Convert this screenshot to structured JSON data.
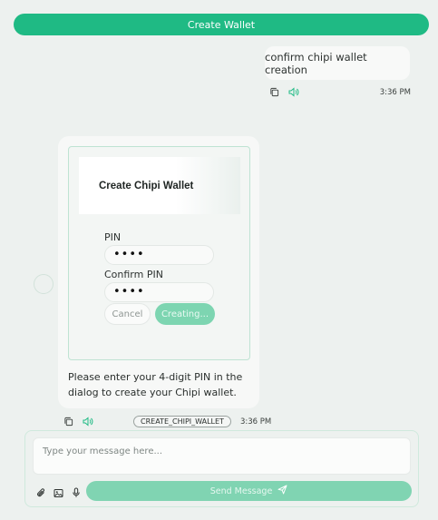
{
  "header": {
    "create_wallet_label": "Create Wallet"
  },
  "user_message": {
    "text": "confirm chipi wallet creation",
    "time": "3:36 PM"
  },
  "bot_message": {
    "dialog": {
      "title": "Create Chipi Wallet",
      "pin_label": "PIN",
      "pin_value": "••••",
      "confirm_label": "Confirm PIN",
      "confirm_value": "••••",
      "cancel_label": "Cancel",
      "creating_label": "Creating..."
    },
    "text": "Please enter your 4-digit PIN in the dialog to create your Chipi wallet.",
    "tool_badge": "CREATE_CHIPI_WALLET",
    "time": "3:36 PM"
  },
  "composer": {
    "placeholder": "Type your message here...",
    "send_label": "Send Message"
  },
  "icons": {
    "copy": "copy-icon",
    "speaker": "speaker-icon",
    "attach": "paperclip-icon",
    "image": "image-icon",
    "mic": "microphone-icon",
    "send": "send-icon"
  },
  "colors": {
    "accent": "#1fba84",
    "accent_soft": "#80d4b2",
    "background": "#edf1ef"
  }
}
